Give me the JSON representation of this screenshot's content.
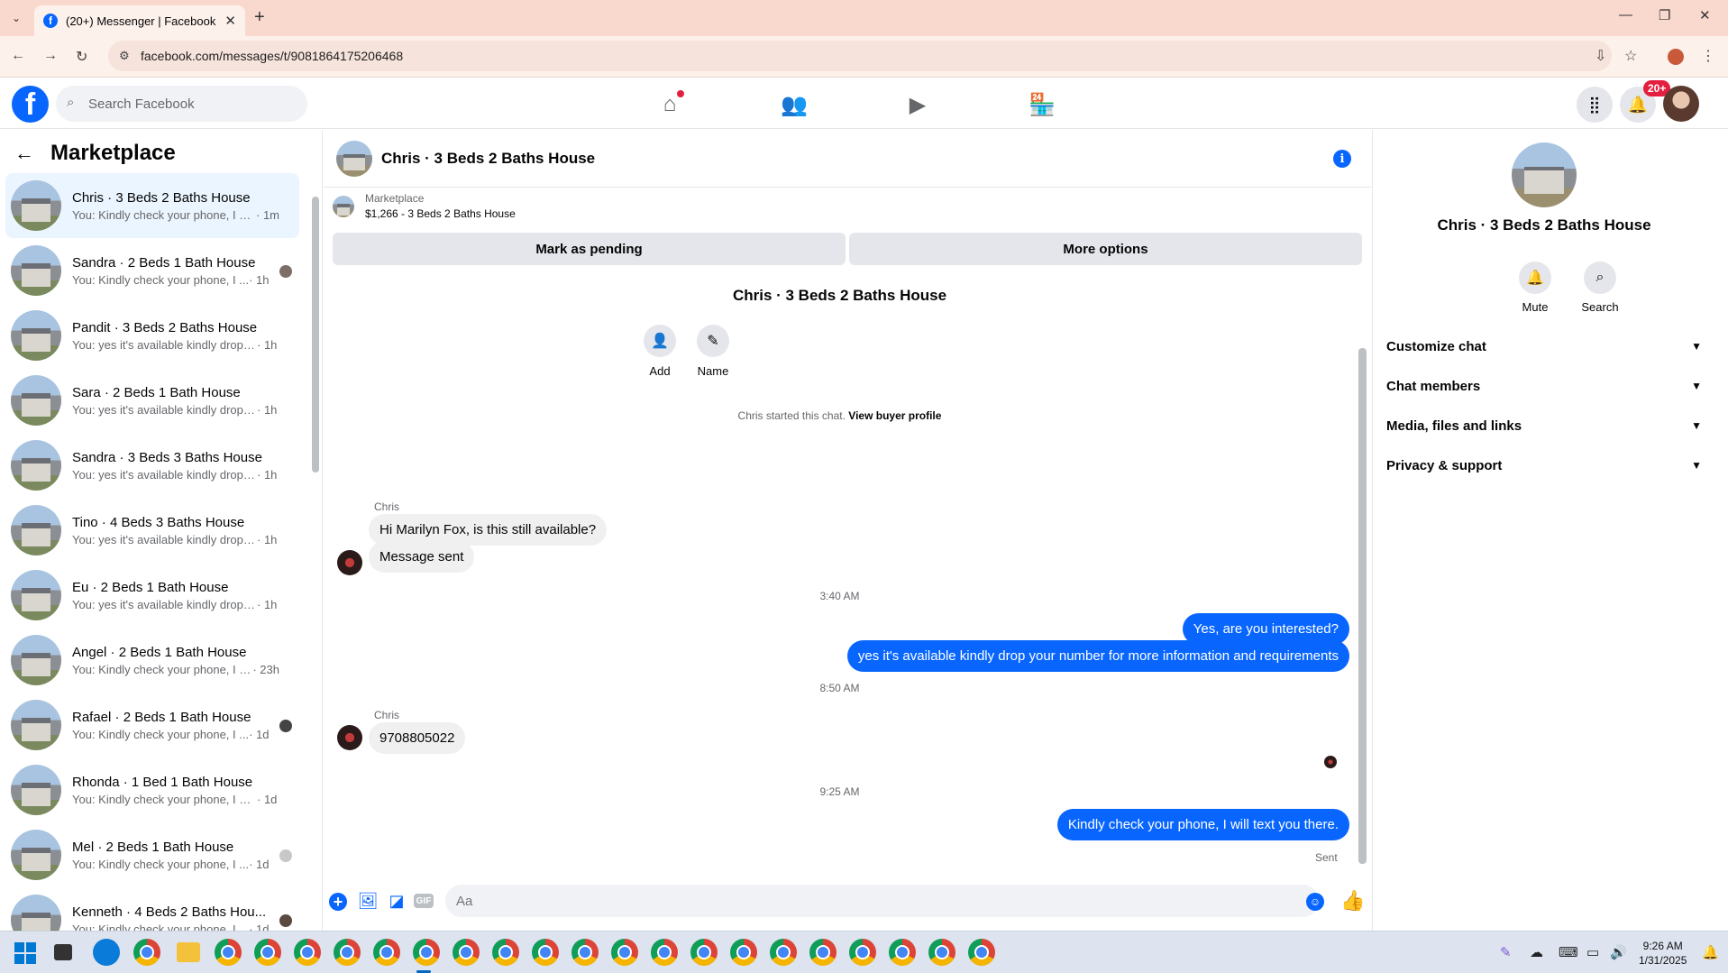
{
  "browser": {
    "tab_title": "(20+) Messenger | Facebook",
    "url": "facebook.com/messages/t/9081864175206468"
  },
  "fbnav": {
    "search_placeholder": "Search Facebook",
    "notif_badge": "20+"
  },
  "sidebar": {
    "title": "Marketplace",
    "conversations": [
      {
        "title": "Chris · 3 Beds 2 Baths House",
        "preview": "You: Kindly check your phone, I wi...",
        "time": "· 1m"
      },
      {
        "title": "Sandra · 2 Beds 1 Bath House",
        "preview": "You: Kindly check your phone, I ...",
        "time": "· 1h"
      },
      {
        "title": "Pandit · 3 Beds 2 Baths House",
        "preview": "You: yes it's available kindly drop y...",
        "time": "· 1h"
      },
      {
        "title": "Sara · 2 Beds 1 Bath House",
        "preview": "You: yes it's available kindly drop y...",
        "time": "· 1h"
      },
      {
        "title": "Sandra · 3 Beds 3 Baths House",
        "preview": "You: yes it's available kindly drop y...",
        "time": "· 1h"
      },
      {
        "title": "Tino · 4 Beds 3 Baths House",
        "preview": "You: yes it's available kindly drop y...",
        "time": "· 1h"
      },
      {
        "title": "Eu · 2 Beds 1 Bath House",
        "preview": "You: yes it's available kindly drop y...",
        "time": "· 1h"
      },
      {
        "title": "Angel · 2 Beds 1 Bath House",
        "preview": "You: Kindly check your phone, I w...",
        "time": "· 23h"
      },
      {
        "title": "Rafael · 2 Beds 1 Bath House",
        "preview": "You: Kindly check your phone, I ...",
        "time": "· 1d"
      },
      {
        "title": "Rhonda · 1 Bed 1 Bath House",
        "preview": "You: Kindly check your phone, I will...",
        "time": "· 1d"
      },
      {
        "title": "Mel · 2 Beds 1 Bath House",
        "preview": "You: Kindly check your phone, I ...",
        "time": "· 1d"
      },
      {
        "title": "Kenneth · 4 Beds 2 Baths Hou...",
        "preview": "You: Kindly check your phone, I ...",
        "time": "· 1d"
      }
    ]
  },
  "chat": {
    "title": "Chris · 3 Beds 2 Baths House",
    "marketplace_label": "Marketplace",
    "listing": "$1,266 - 3 Beds 2 Baths House",
    "mark_pending": "Mark as pending",
    "more_options": "More options",
    "profile_name": "Chris · 3 Beds 2 Baths House",
    "add_label": "Add",
    "name_label": "Name",
    "started_text": "Chris started this chat.",
    "view_buyer": "View buyer profile",
    "sender1": "Chris",
    "msg1": "Hi Marilyn Fox, is this still available?",
    "msg2": "Message sent",
    "ts1": "3:40 AM",
    "out1": "Yes, are you interested?",
    "out2": "yes it's available kindly drop your number for more information and requirements",
    "ts2": "8:50 AM",
    "sender2": "Chris",
    "msg3": "9708805022",
    "ts3": "9:25 AM",
    "out3": "Kindly check your phone, I will text you there.",
    "sent_status": "Sent",
    "input_placeholder": "Aa"
  },
  "rpanel": {
    "name": "Chris · 3 Beds 2 Baths House",
    "mute": "Mute",
    "search": "Search",
    "sections": [
      "Customize chat",
      "Chat members",
      "Media, files and links",
      "Privacy & support"
    ]
  },
  "taskbar": {
    "time": "9:26 AM",
    "date": "1/31/2025"
  },
  "colors": {
    "accent": "#0866ff",
    "active_conv_bg": "#ebf5ff",
    "tab_bar": "#f9d9cd"
  }
}
